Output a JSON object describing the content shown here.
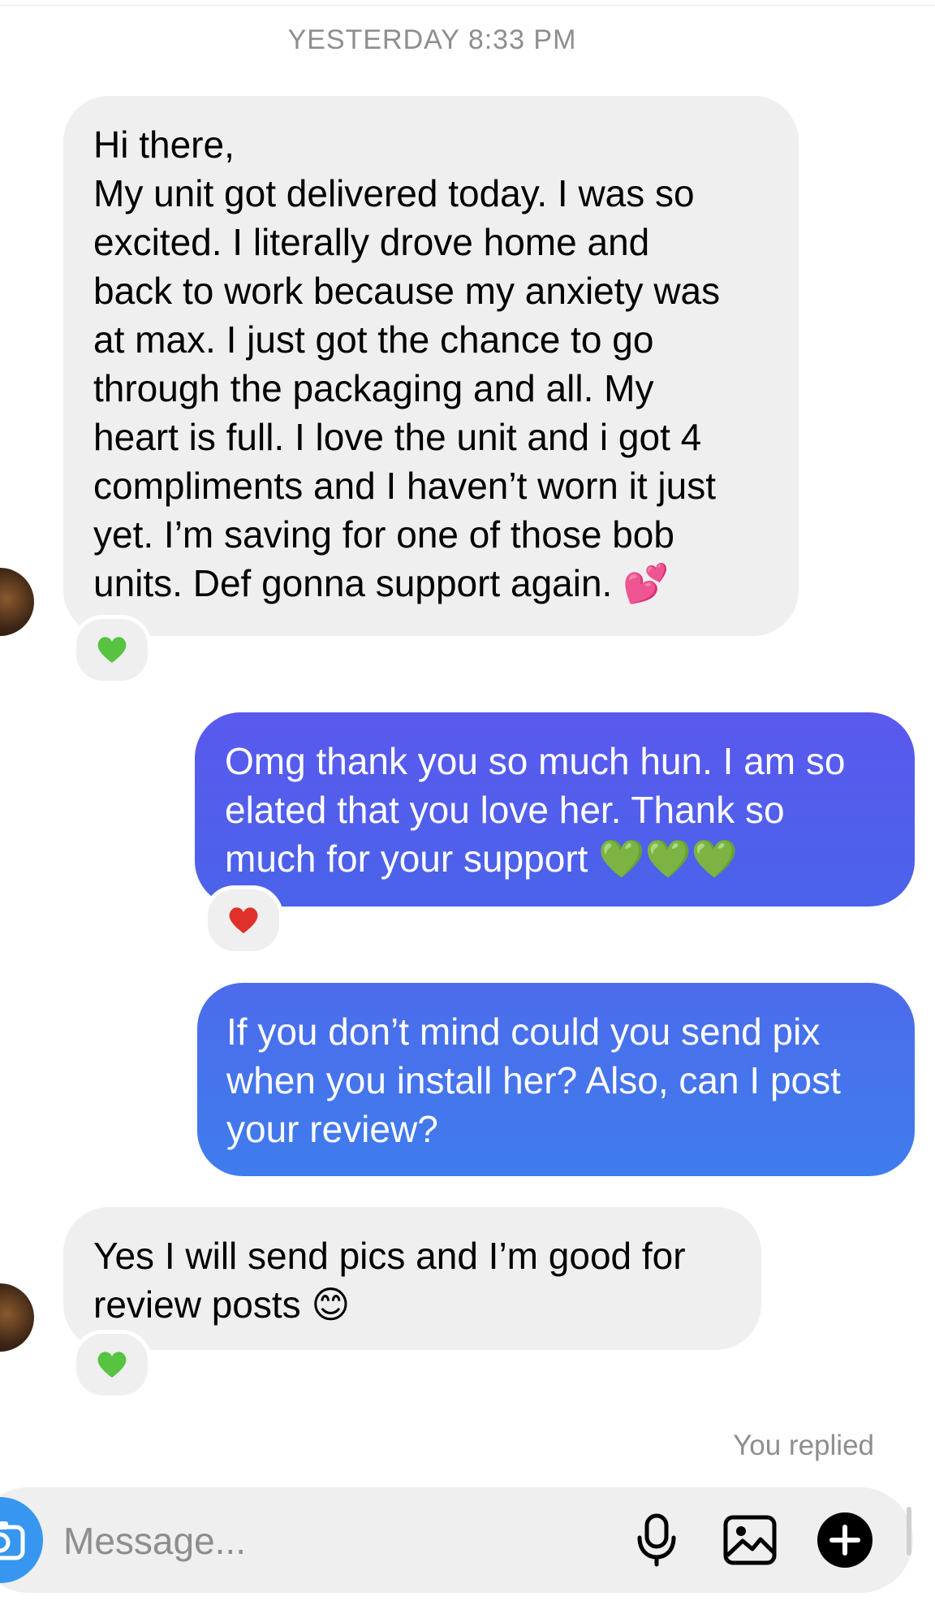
{
  "thread": {
    "timestamp": "YESTERDAY 8:33 PM",
    "messages": [
      {
        "direction": "received",
        "text": "Hi there,\nMy unit got delivered today. I was so\nexcited. I literally drove home and\nback to work because my anxiety was\nat max. I just got the chance to go\nthrough the packaging and all. My\nheart is full. I love the unit and i got 4\ncompliments and I haven’t worn it just\nyet. I’m saving for one of those bob\nunits. Def gonna support again. 💕",
        "reaction": "💚"
      },
      {
        "direction": "sent",
        "text": "Omg thank you so much hun. I am so\nelated that you love her. Thank so\nmuch for your support 💚💚💚",
        "reaction": "❤️"
      },
      {
        "direction": "sent",
        "text": "If you don’t mind could you send pix\nwhen you install her? Also, can I post\nyour review?",
        "reaction": ""
      },
      {
        "direction": "received",
        "text": "Yes I will send pics and I’m good for\nreview posts 😊",
        "reaction": "💚"
      }
    ],
    "status": "You replied"
  },
  "composer": {
    "placeholder": "Message...",
    "value": "",
    "icons": [
      "camera-icon",
      "microphone-icon",
      "gallery-icon",
      "plus-icon"
    ]
  },
  "colors": {
    "received_bubble": "#efefef",
    "sent_bubble_top": "#5a59ee",
    "sent_bubble_bottom": "#3f7ced",
    "secondary_text": "#8e8e8e",
    "camera_button": "#3797f0"
  }
}
